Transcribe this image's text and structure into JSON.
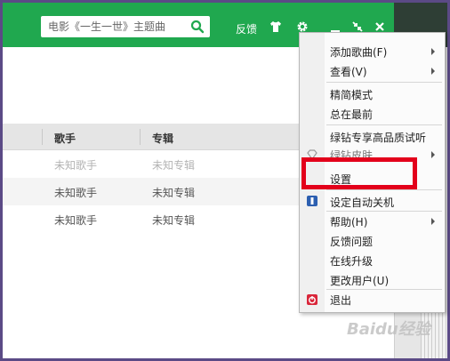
{
  "header": {
    "search_placeholder": "电影《一生一世》主题曲",
    "feedback_label": "反馈"
  },
  "table": {
    "headers": [
      "歌手",
      "专辑"
    ],
    "rows": [
      {
        "artist": "未知歌手",
        "album": "未知专辑"
      },
      {
        "artist": "未知歌手",
        "album": "未知专辑"
      },
      {
        "artist": "未知歌手",
        "album": "未知专辑"
      }
    ]
  },
  "menu": {
    "items": [
      {
        "label": "添加歌曲(F)",
        "submenu": true
      },
      {
        "label": "查看(V)",
        "submenu": true
      },
      {
        "label": "精简模式",
        "submenu": false
      },
      {
        "label": "总在最前",
        "submenu": false
      },
      {
        "label": "绿钻专享高品质试听",
        "submenu": false
      },
      {
        "label": "绿钻皮肤",
        "submenu": true
      },
      {
        "label": "设置",
        "submenu": false
      },
      {
        "label": "设定自动关机",
        "submenu": false
      },
      {
        "label": "帮助(H)",
        "submenu": true
      },
      {
        "label": "反馈问题",
        "submenu": false
      },
      {
        "label": "在线升级",
        "submenu": false
      },
      {
        "label": "更改用户(U)",
        "submenu": false
      },
      {
        "label": "退出",
        "submenu": false
      }
    ]
  },
  "watermark_text": "Baidu经验",
  "colors": {
    "header_green": "#20a84f",
    "highlight_red": "#e3001b"
  }
}
